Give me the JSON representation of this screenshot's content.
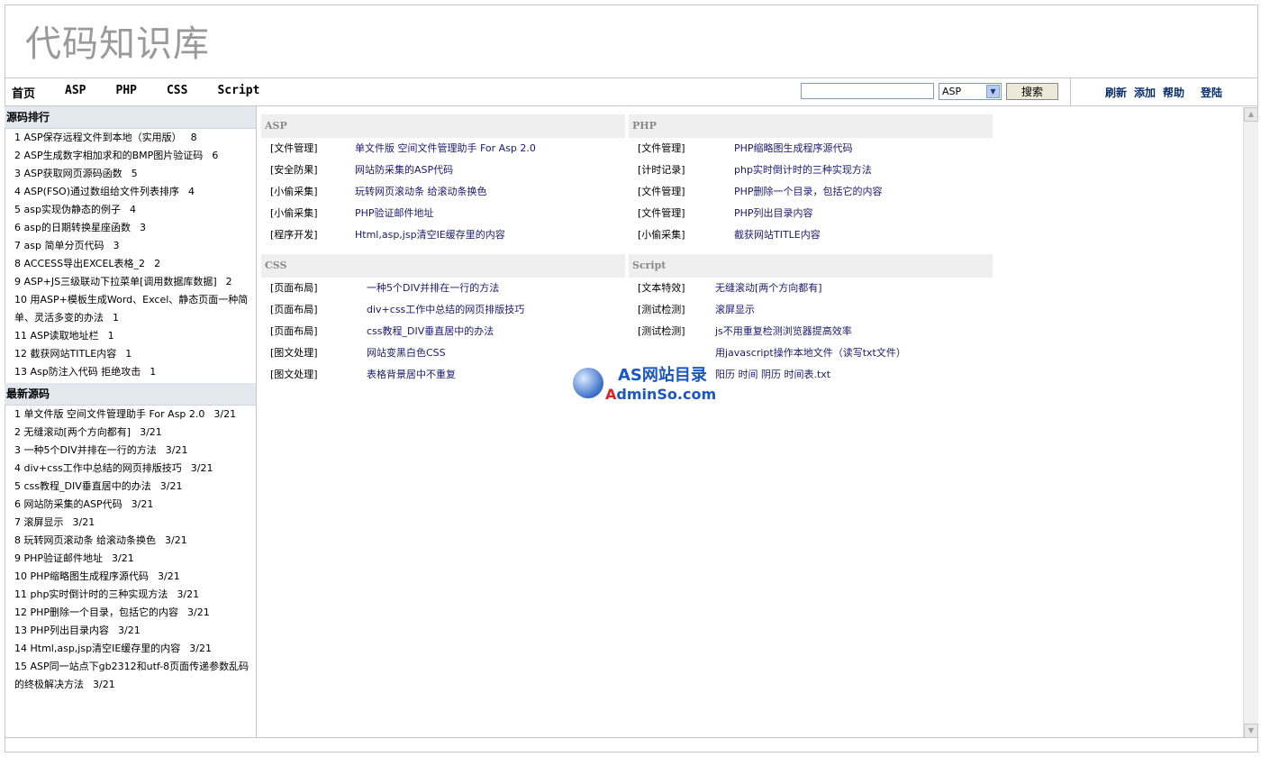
{
  "header": {
    "title": "代码知识库"
  },
  "nav": {
    "items": [
      "首页",
      "ASP",
      "PHP",
      "CSS",
      "Script"
    ]
  },
  "search": {
    "query": "",
    "select_value": "ASP",
    "button_label": "搜索"
  },
  "user_links": {
    "refresh": "刷新",
    "add": "添加",
    "help": "帮助",
    "login": "登陆"
  },
  "sidebar": {
    "ranking": {
      "title": "源码排行",
      "items": [
        {
          "n": "1",
          "title": "ASP保存远程文件到本地（实用版）",
          "count": "8"
        },
        {
          "n": "2",
          "title": "ASP生成数字相加求和的BMP图片验证码",
          "count": "6"
        },
        {
          "n": "3",
          "title": "ASP获取网页源码函数",
          "count": "5"
        },
        {
          "n": "4",
          "title": "ASP(FSO)通过数组给文件列表排序",
          "count": "4"
        },
        {
          "n": "5",
          "title": "asp实现伪静态的例子",
          "count": "4"
        },
        {
          "n": "6",
          "title": "asp的日期转换星座函数",
          "count": "3"
        },
        {
          "n": "7",
          "title": "asp 简单分页代码",
          "count": "3"
        },
        {
          "n": "8",
          "title": "ACCESS导出EXCEL表格_2",
          "count": "2"
        },
        {
          "n": "9",
          "title": "ASP+JS三级联动下拉菜单[调用数据库数据]",
          "count": "2"
        },
        {
          "n": "10",
          "title": "用ASP+模板生成Word、Excel、静态页面一种简单、灵活多变的办法",
          "count": "1"
        },
        {
          "n": "11",
          "title": "ASP读取地址栏",
          "count": "1"
        },
        {
          "n": "12",
          "title": "截获网站TITLE内容",
          "count": "1"
        },
        {
          "n": "13",
          "title": "Asp防注入代码 拒绝攻击",
          "count": "1"
        }
      ]
    },
    "latest": {
      "title": "最新源码",
      "items": [
        {
          "n": "1",
          "title": "单文件版 空间文件管理助手 For Asp 2.0",
          "date": "3/21"
        },
        {
          "n": "2",
          "title": "无缝滚动[两个方向都有]",
          "date": "3/21"
        },
        {
          "n": "3",
          "title": "一种5个DIV并排在一行的方法",
          "date": "3/21"
        },
        {
          "n": "4",
          "title": "div+css工作中总结的网页排版技巧",
          "date": "3/21"
        },
        {
          "n": "5",
          "title": "css教程_DIV垂直居中的办法",
          "date": "3/21"
        },
        {
          "n": "6",
          "title": "网站防采集的ASP代码",
          "date": "3/21"
        },
        {
          "n": "7",
          "title": "滚屏显示",
          "date": "3/21"
        },
        {
          "n": "8",
          "title": "玩转网页滚动条 给滚动条换色",
          "date": "3/21"
        },
        {
          "n": "9",
          "title": "PHP验证邮件地址",
          "date": "3/21"
        },
        {
          "n": "10",
          "title": "PHP缩略图生成程序源代码",
          "date": "3/21"
        },
        {
          "n": "11",
          "title": "php实时倒计时的三种实现方法",
          "date": "3/21"
        },
        {
          "n": "12",
          "title": "PHP删除一个目录，包括它的内容",
          "date": "3/21"
        },
        {
          "n": "13",
          "title": "PHP列出目录内容",
          "date": "3/21"
        },
        {
          "n": "14",
          "title": "Html,asp,jsp清空IE缓存里的内容",
          "date": "3/21"
        },
        {
          "n": "15",
          "title": "ASP同一站点下gb2312和utf-8页面传递参数乱码的终极解决方法",
          "date": "3/21"
        }
      ]
    }
  },
  "panels": {
    "asp": {
      "title": "ASP",
      "rows": [
        {
          "cat": "[文件管理]",
          "title": "单文件版 空间文件管理助手 For Asp 2.0"
        },
        {
          "cat": "[安全防果]",
          "title": "网站防采集的ASP代码"
        },
        {
          "cat": "[小偷采集]",
          "title": "玩转网页滚动条 给滚动条换色"
        },
        {
          "cat": "[小偷采集]",
          "title": "PHP验证邮件地址"
        },
        {
          "cat": "[程序开发]",
          "title": "Html,asp,jsp清空IE缓存里的内容"
        }
      ]
    },
    "php": {
      "title": "PHP",
      "rows": [
        {
          "cat": "[文件管理]",
          "title": "PHP缩略图生成程序源代码"
        },
        {
          "cat": "[计时记录]",
          "title": "php实时倒计时的三种实现方法"
        },
        {
          "cat": "[文件管理]",
          "title": "PHP删除一个目录，包括它的内容"
        },
        {
          "cat": "[文件管理]",
          "title": "PHP列出目录内容"
        },
        {
          "cat": "[小偷采集]",
          "title": "截获网站TITLE内容"
        }
      ]
    },
    "css": {
      "title": "CSS",
      "rows": [
        {
          "cat": "[页面布局]",
          "title": "一种5个DIV并排在一行的方法"
        },
        {
          "cat": "[页面布局]",
          "title": "div+css工作中总结的网页排版技巧"
        },
        {
          "cat": "[页面布局]",
          "title": "css教程_DIV垂直居中的办法"
        },
        {
          "cat": "[图文处理]",
          "title": "网站变黑白色CSS"
        },
        {
          "cat": "[图文处理]",
          "title": "表格背景居中不重复"
        }
      ]
    },
    "script": {
      "title": "Script",
      "rows": [
        {
          "cat": "[文本特效]",
          "title": "无缝滚动[两个方向都有]"
        },
        {
          "cat": "[测试检测]",
          "title": "滚屏显示"
        },
        {
          "cat": "[测试检测]",
          "title": "js不用重复检测浏览器提高效率"
        },
        {
          "cat": "",
          "title": "用javascript操作本地文件（读写txt文件）"
        },
        {
          "cat": "",
          "title": "阳历 时间 阴历 时间表.txt"
        }
      ]
    }
  },
  "watermark": {
    "top_text": "AS网站目录",
    "bottom_a": "A",
    "bottom_rest": "dminSo.com"
  }
}
